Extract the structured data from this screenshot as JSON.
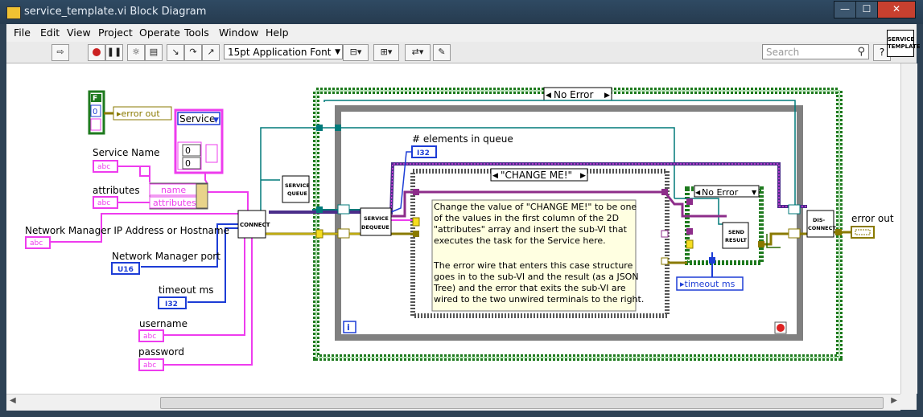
{
  "window": {
    "title": "service_template.vi Block Diagram",
    "controls": {
      "minimize": "—",
      "maximize": "☐",
      "close": "✕"
    }
  },
  "menu": [
    "File",
    "Edit",
    "View",
    "Project",
    "Operate",
    "Tools",
    "Window",
    "Help"
  ],
  "toolbar": {
    "font": "15pt Application Font",
    "search_placeholder": "Search",
    "help": "?",
    "icons": [
      "run-arrow-icon",
      "abort-icon",
      "pause-icon",
      "highlight-execution-icon",
      "retain-wire-values-icon",
      "step-into-icon",
      "step-over-icon",
      "step-out-icon",
      "text-settings-icon",
      "align-icon",
      "distribute-icon",
      "reorder-icon",
      "cleanup-icon"
    ]
  },
  "vi_icon": {
    "line1": "SERVICE",
    "line2": "TEMPLATE"
  },
  "diagram": {
    "error_out_top": "error out",
    "bool_f": "F",
    "bool_0": "0",
    "service_cluster": {
      "title": "Service",
      "v1": "0",
      "v2": "0"
    },
    "bundle": {
      "name": "name",
      "attributes": "attributes"
    },
    "labels": {
      "service_name": "Service Name",
      "attributes": "attributes",
      "nm_ip": "Network Manager IP Address or Hostname",
      "nm_port": "Network Manager port",
      "timeout": "timeout ms",
      "username": "username",
      "password": "password",
      "elements_in_queue": "# elements in queue",
      "error_out_right": "error out",
      "timeout_const": "timeout ms"
    },
    "terminals": {
      "abc": "abc",
      "u16": "U16",
      "i32": "I32"
    },
    "subvis": {
      "connect": "CONNECT",
      "service_queue_1": "SERVICE",
      "service_queue_2": "QUEUE",
      "service_dequeue_1": "SERVICE",
      "service_dequeue_2": "DEQUEUE",
      "send_result_1": "SEND",
      "send_result_2": "RESULT",
      "disconnect_1": "DIS-",
      "disconnect_2": "CONNECT"
    },
    "case_outer": "No Error",
    "case_inner": "\"CHANGE ME!\"",
    "case_send": "No Error",
    "loop_index": "i",
    "comment": [
      "Change the value of \"CHANGE ME!\" to be one",
      "of the values in the first column of the 2D",
      "\"attributes\" array and insert the sub-VI that",
      "executes the task for the Service here.",
      "",
      "The error wire that enters this case structure",
      "goes in to the sub-VI and the result (as a JSON",
      "Tree) and the error that exits the sub-VI are",
      "wired to the two unwired terminals to the right."
    ],
    "colors": {
      "string_wire": "#ee3cee",
      "error_wire": "#8a7a00",
      "numeric_wire": "#1d3dd6",
      "ref_wire": "#007a7a",
      "case_frame": "#1e7a1e",
      "loop_frame": "#7a7a7a",
      "comment_bg": "#ffffe1"
    }
  }
}
